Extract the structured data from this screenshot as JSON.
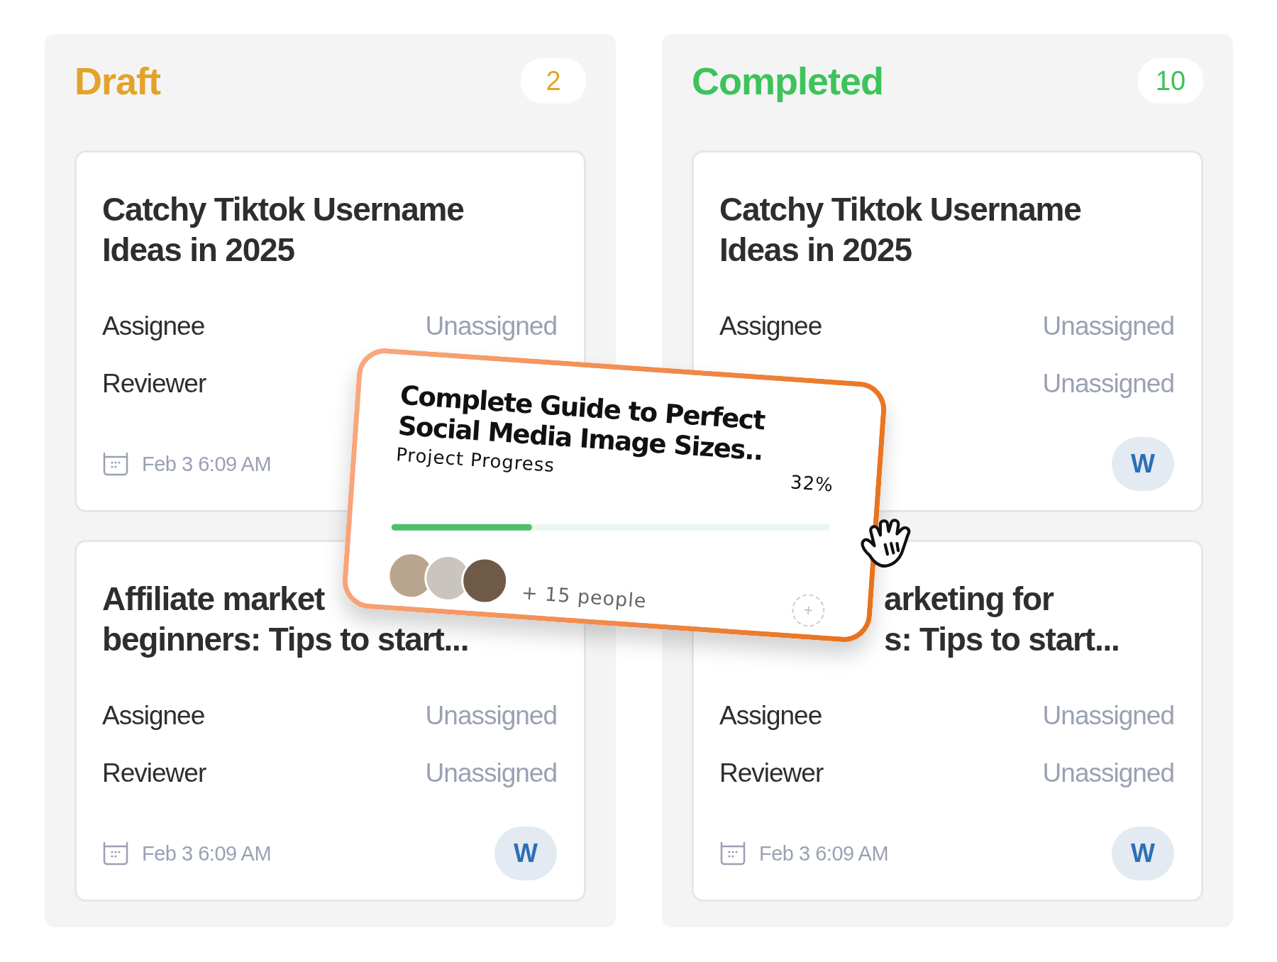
{
  "columns": [
    {
      "title": "Draft",
      "color": "#e3a32a",
      "count": "2",
      "cards": [
        {
          "title_lines": [
            "Catchy Tiktok Username",
            "Ideas in 2025"
          ],
          "rows": [
            {
              "label": "Assignee",
              "value": "Unassigned"
            },
            {
              "label": "Reviewer"
            }
          ],
          "date": "Feb 3 6:09 AM"
        },
        {
          "title_lines": [
            "Affiliate market",
            "beginners: Tips to start..."
          ],
          "rows": [
            {
              "label": "Assignee",
              "value": "Unassigned"
            },
            {
              "label": "Reviewer",
              "value": "Unassigned"
            }
          ],
          "date": "Feb 3 6:09 AM",
          "avatar": "W"
        }
      ]
    },
    {
      "title": "Completed",
      "color": "#3cc35a",
      "count": "10",
      "cards": [
        {
          "title_lines": [
            "Catchy Tiktok Username",
            "Ideas in 2025"
          ],
          "rows": [
            {
              "label": "Assignee",
              "value": "Unassigned"
            },
            {
              "value": "Unassigned"
            }
          ],
          "avatar": "W"
        },
        {
          "title_lines": [
            "arketing for",
            "s: Tips to start..."
          ],
          "rows": [
            {
              "label": "Assignee",
              "value": "Unassigned"
            },
            {
              "label": "Reviewer",
              "value": "Unassigned"
            }
          ],
          "date": "Feb 3 6:09 AM",
          "avatar": "W"
        }
      ]
    }
  ],
  "dragged_card": {
    "title": "Complete Guide to Perfect Social Media Image Sizes..",
    "progress_label": "Project Progress",
    "reading": "32%",
    "level": 0.32,
    "people_count": "+ 15 people",
    "add_button": "+"
  }
}
